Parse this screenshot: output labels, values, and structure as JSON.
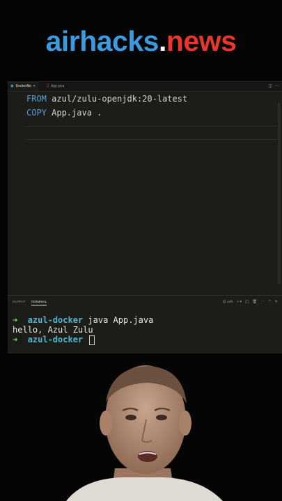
{
  "brand": {
    "part1": "airhacks",
    "dot": ".",
    "part2": "news"
  },
  "editor": {
    "tabs": [
      {
        "label": "Dockerfile",
        "icon": "docker-icon",
        "close": "×",
        "active": true
      },
      {
        "label": "App.java",
        "icon": "java-icon",
        "active": false
      }
    ],
    "code_lines": [
      {
        "keyword": "FROM",
        "rest": " azul/zulu-openjdk:20-latest"
      },
      {
        "keyword": "COPY",
        "rest": " App.java ."
      }
    ]
  },
  "panel": {
    "tabs": [
      {
        "label": "OUTPUT",
        "active": false
      },
      {
        "label": "TERMINAL",
        "active": true
      }
    ],
    "shell": "zsh",
    "terminal": {
      "prompt_arrow": "➜",
      "directory": "azul-docker",
      "command": " java App.java",
      "output": "hello, Azul Zulu"
    }
  },
  "colors": {
    "brand_blue": "#3b9be0",
    "brand_red": "#e8362a",
    "keyword": "#569cd6",
    "prompt_dir": "#4fb6d0",
    "prompt_arrow": "#7fcf6a"
  }
}
